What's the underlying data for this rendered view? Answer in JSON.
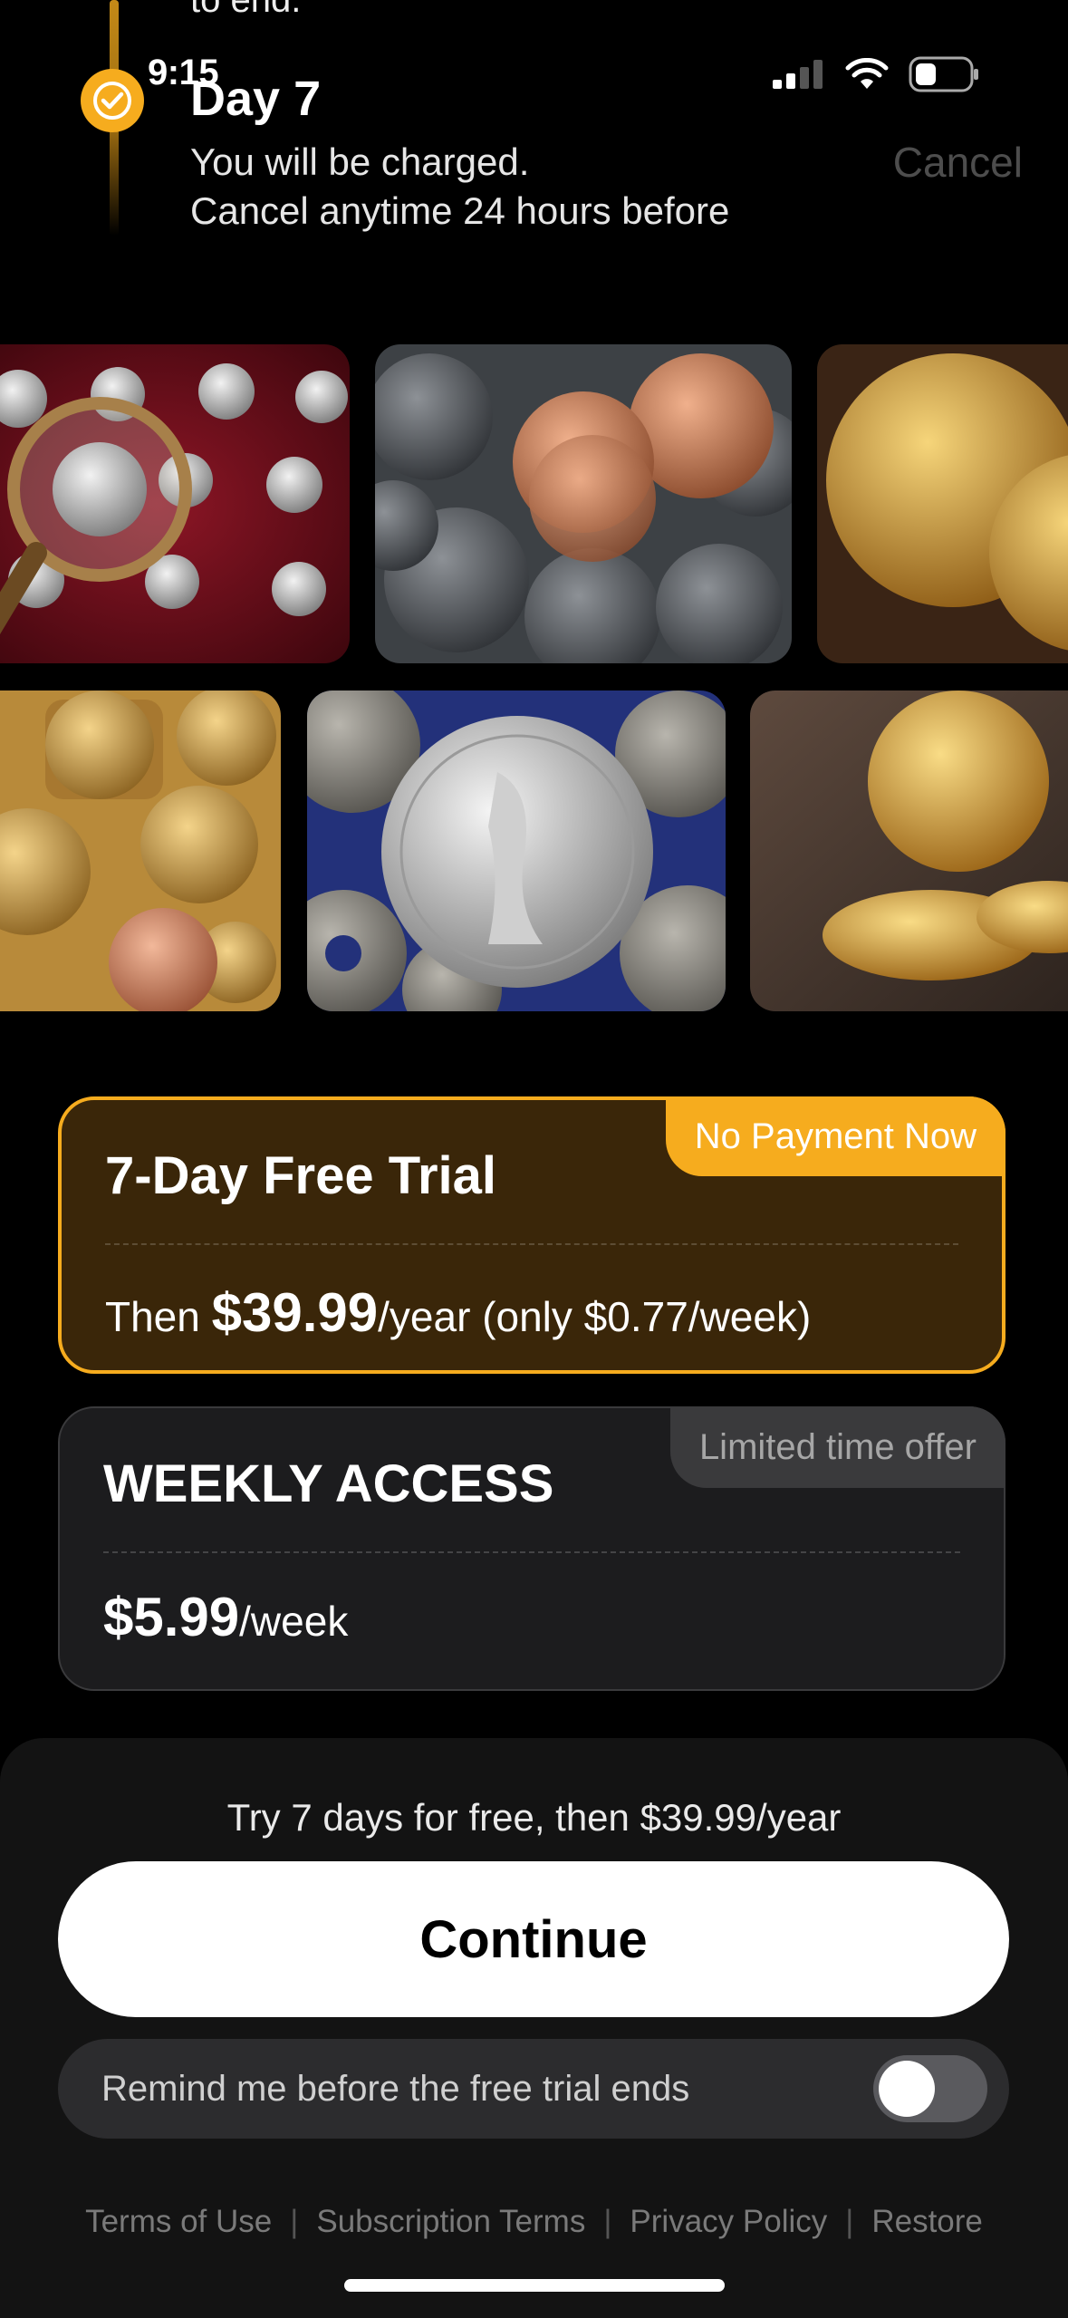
{
  "status_bar": {
    "time": "9:15"
  },
  "timeline": {
    "previous_text": "to end.",
    "day_title": "Day 7",
    "description_line1": "You will be charged.",
    "description_line2": "Cancel anytime 24 hours before",
    "cancel_label": "Cancel"
  },
  "gallery": {
    "row1": [
      "silver-coins-magnifier-photo",
      "us-pennies-photo",
      "gold-coins-photo"
    ],
    "row2": [
      "euro-cent-coins-photo",
      "french-franc-coin-photo",
      "gold-sovereign-photo"
    ]
  },
  "plans": {
    "trial": {
      "badge": "No Payment Now",
      "title": "7-Day Free Trial",
      "price_prefix": "Then ",
      "price": "$39.99",
      "price_suffix": "/year (only $0.77/week)",
      "selected": true
    },
    "weekly": {
      "badge": "Limited time offer",
      "title": "WEEKLY ACCESS",
      "price": "$5.99",
      "price_suffix": "/week",
      "selected": false
    }
  },
  "checkout": {
    "offer_line": "Try 7 days for free, then $39.99/year",
    "continue_label": "Continue",
    "remind_label": "Remind me before the free trial ends",
    "remind_enabled": false
  },
  "footer": {
    "links": [
      "Terms of Use",
      "Subscription Terms",
      "Privacy Policy",
      "Restore"
    ]
  },
  "colors": {
    "accent": "#f6ac1e",
    "trial_card_bg": "#3a2609",
    "card_bg": "#1c1c1e",
    "sheet_bg": "#131313"
  }
}
